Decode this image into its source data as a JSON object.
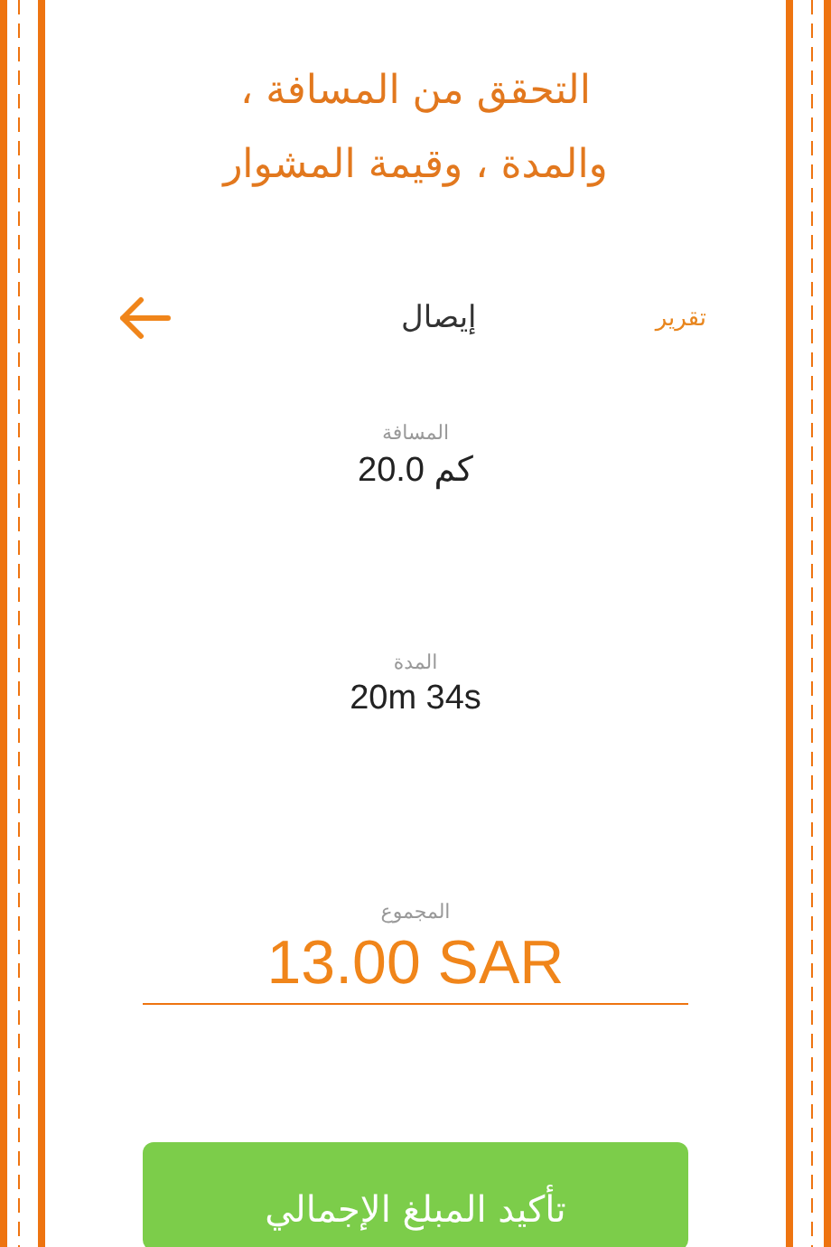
{
  "heading": "التحقق من المسافة ، والمدة ، وقيمة المشوار",
  "nav": {
    "title": "إيصال",
    "action": "تقرير"
  },
  "fields": [
    {
      "kind": "plain",
      "label": "المسافة",
      "value": "20.0 كم"
    },
    {
      "kind": "plain",
      "label": "المدة",
      "value": "20m 34s"
    },
    {
      "kind": "total",
      "label": "المجموع",
      "value": "13.00 SAR"
    }
  ],
  "button": {
    "label": "تأكيد المبلغ الإجمالي"
  }
}
